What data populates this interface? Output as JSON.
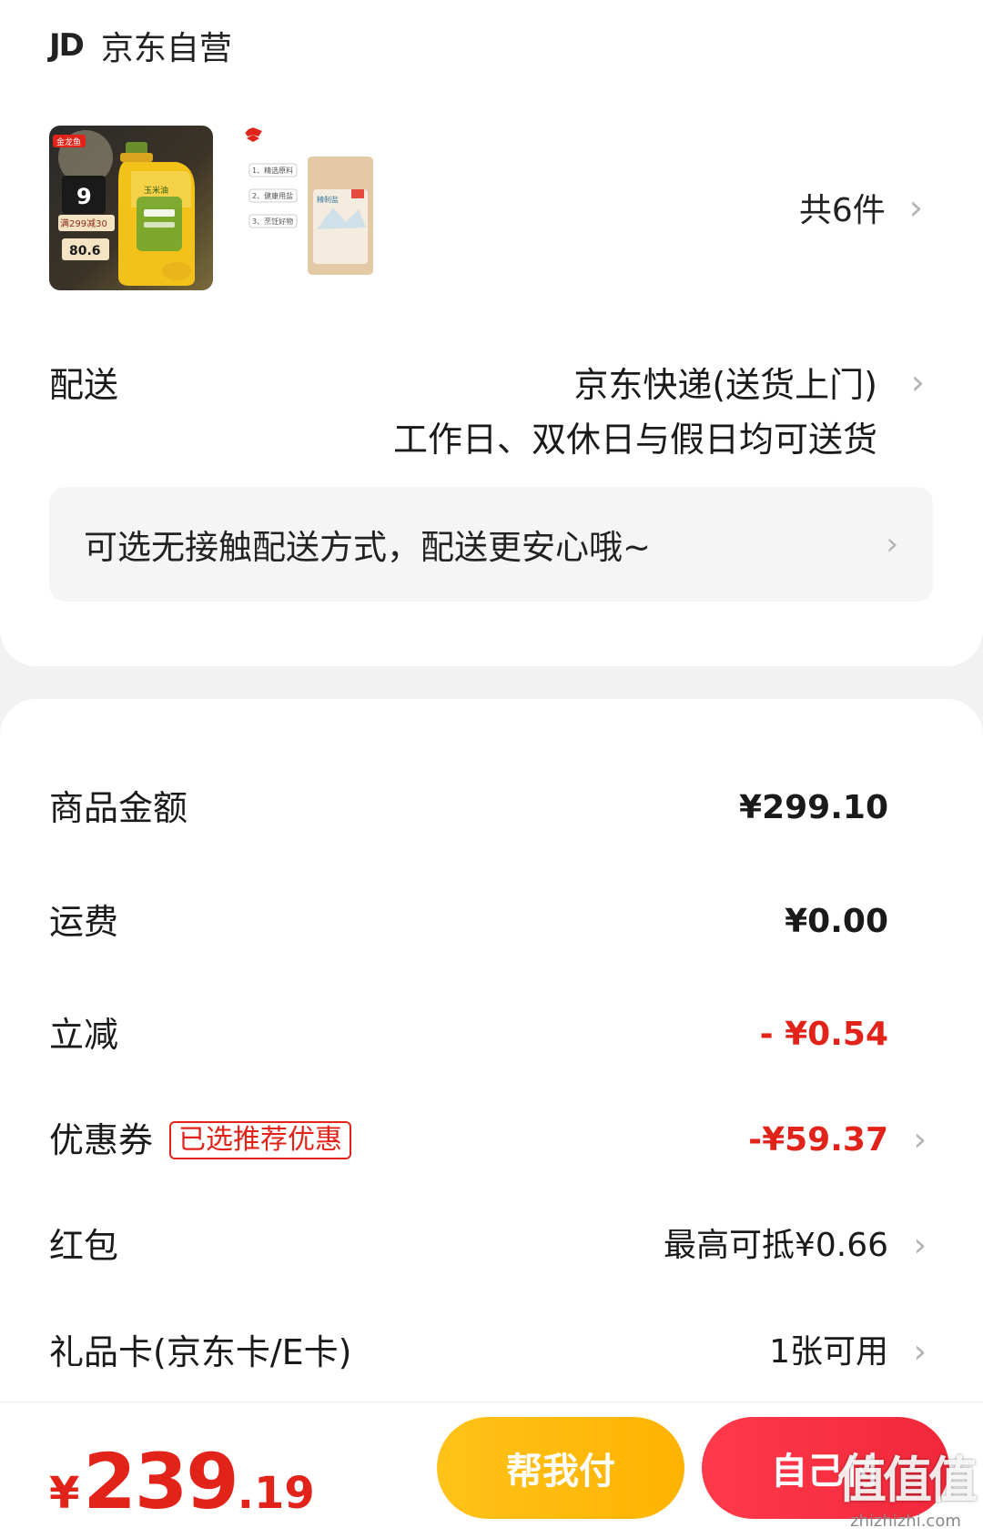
{
  "store": {
    "logo_text": "JD",
    "name": "京东自营"
  },
  "items": {
    "count_label": "共6件",
    "thumb1": {
      "brand": "金龙鱼",
      "badge": "9",
      "promo": "满299减30",
      "price": "80.6",
      "product": "玉米油"
    },
    "thumb2": {
      "lines": [
        "1、精选原料",
        "2、健康用盐",
        "3、烹饪好物"
      ],
      "product": "精制盐"
    }
  },
  "delivery": {
    "label": "配送",
    "method": "京东快递(送货上门)",
    "days": "工作日、双休日与假日均可送货",
    "contactless_text": "可选无接触配送方式，配送更安心哦~"
  },
  "summary": {
    "rows": [
      {
        "label": "商品金额",
        "value": "¥299.10"
      },
      {
        "label": "运费",
        "value": "¥0.00"
      },
      {
        "label": "立减",
        "value": "- ¥0.54"
      },
      {
        "label": "优惠券",
        "tag": "已选推荐优惠",
        "value": "-¥59.37"
      },
      {
        "label": "红包",
        "value": "最高可抵¥0.66"
      },
      {
        "label": "礼品卡(京东卡/E卡)",
        "value": "1张可用"
      }
    ]
  },
  "footer": {
    "total_yen": "¥",
    "total_int": "239",
    "total_dec": ".19",
    "help_pay": "帮我付",
    "self_pay": "自己付",
    "watermark_big": "值值值",
    "watermark_small": "zhizhizhi.com"
  },
  "colors": {
    "red": "#e2231a",
    "yellow": "#ffc21a",
    "pay_red": "#f1273a"
  }
}
